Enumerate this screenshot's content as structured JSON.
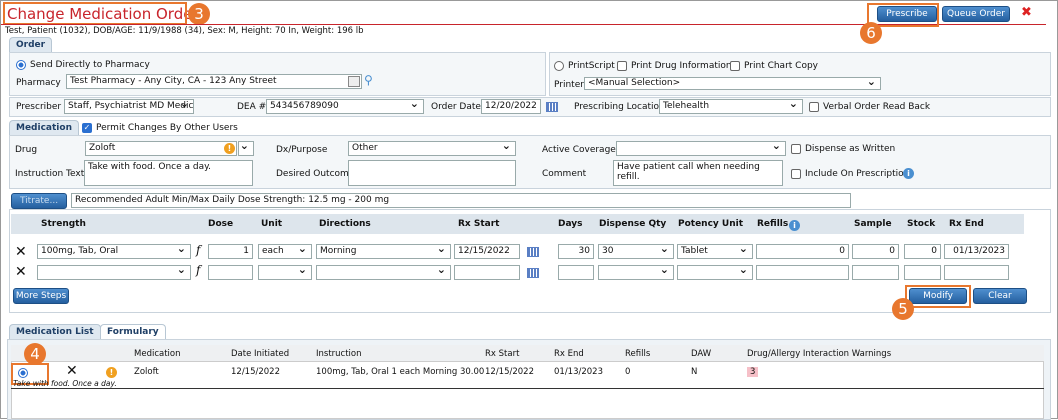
{
  "header": {
    "title": "Change Medication Order",
    "patient": "Test, Patient (1032), DOB/AGE: 11/9/1988 (34), Sex: M, Height: 70 In, Weight: 196 lb",
    "prescribe": "Prescribe",
    "queue": "Queue Order",
    "close": "✖"
  },
  "callouts": {
    "c3": "3",
    "c4": "4",
    "c5": "5",
    "c6": "6"
  },
  "order": {
    "tab": "Order",
    "send_directly": "Send Directly to Pharmacy",
    "pharmacy_label": "Pharmacy",
    "pharmacy": "Test Pharmacy - Any City, CA - 123 Any Street",
    "printscript": "PrintScript",
    "print_drug_info": "Print Drug Information",
    "print_chart_copy": "Print Chart Copy",
    "printer_label": "Printer",
    "printer": "<Manual Selection>",
    "prescriber_label": "Prescriber",
    "prescriber": "Staff, Psychiatrist MD Medical Dc",
    "dea_label": "DEA #",
    "dea": "543456789090",
    "order_date_label": "Order Date",
    "order_date": "12/20/2022",
    "location_label": "Prescribing Location",
    "location": "Telehealth",
    "verbal": "Verbal Order Read Back"
  },
  "medication": {
    "tab": "Medication",
    "permit": "Permit Changes By Other Users",
    "drug_label": "Drug",
    "drug": "Zoloft",
    "dx_label": "Dx/Purpose",
    "dx": "Other",
    "coverage_label": "Active Coverage",
    "coverage": "",
    "daw": "Dispense as Written",
    "instruction_label": "Instruction Text",
    "instruction": "Take with food.  Once a day.",
    "outcome_label": "Desired Outcome",
    "outcome": "",
    "comment_label": "Comment",
    "comment": "Have patient call when needing refill.",
    "include": "Include On Prescription",
    "titrate": "Titrate...",
    "recommended": "Recommended Adult Min/Max Daily Dose Strength: 12.5 mg - 200 mg"
  },
  "steps": {
    "headers": [
      "Strength",
      "Dose",
      "Unit",
      "Directions",
      "Rx Start",
      "Days",
      "Dispense Qty",
      "Potency Unit",
      "Refills",
      "Sample",
      "Stock",
      "Rx End"
    ],
    "rows": [
      {
        "strength": "100mg, Tab, Oral",
        "dose": "1",
        "unit": "each",
        "directions": "Morning",
        "rx_start": "12/15/2022",
        "days": "30",
        "qty": "30",
        "potency": "Tablet",
        "refills": "0",
        "sample": "0",
        "stock": "0",
        "rx_end": "01/13/2023"
      },
      {
        "strength": "",
        "dose": "",
        "unit": "",
        "directions": "",
        "rx_start": "",
        "days": "",
        "qty": "",
        "potency": "",
        "refills": "",
        "sample": "",
        "stock": "",
        "rx_end": ""
      }
    ],
    "more_steps": "More Steps",
    "modify": "Modify",
    "clear": "Clear"
  },
  "list": {
    "tabs": [
      "Medication List",
      "Formulary"
    ],
    "headers": [
      "Medication",
      "Date Initiated",
      "Instruction",
      "Rx Start",
      "Rx End",
      "Refills",
      "DAW",
      "Drug/Allergy Interaction Warnings"
    ],
    "row": {
      "medication": "Zoloft",
      "date": "12/15/2022",
      "instruction": "100mg, Tab, Oral 1 each Morning 30.00",
      "rx_start": "12/15/2022",
      "rx_end": "01/13/2023",
      "refills": "0",
      "daw": "N",
      "warnings": "3",
      "note": "Take with food. Once a day."
    }
  }
}
